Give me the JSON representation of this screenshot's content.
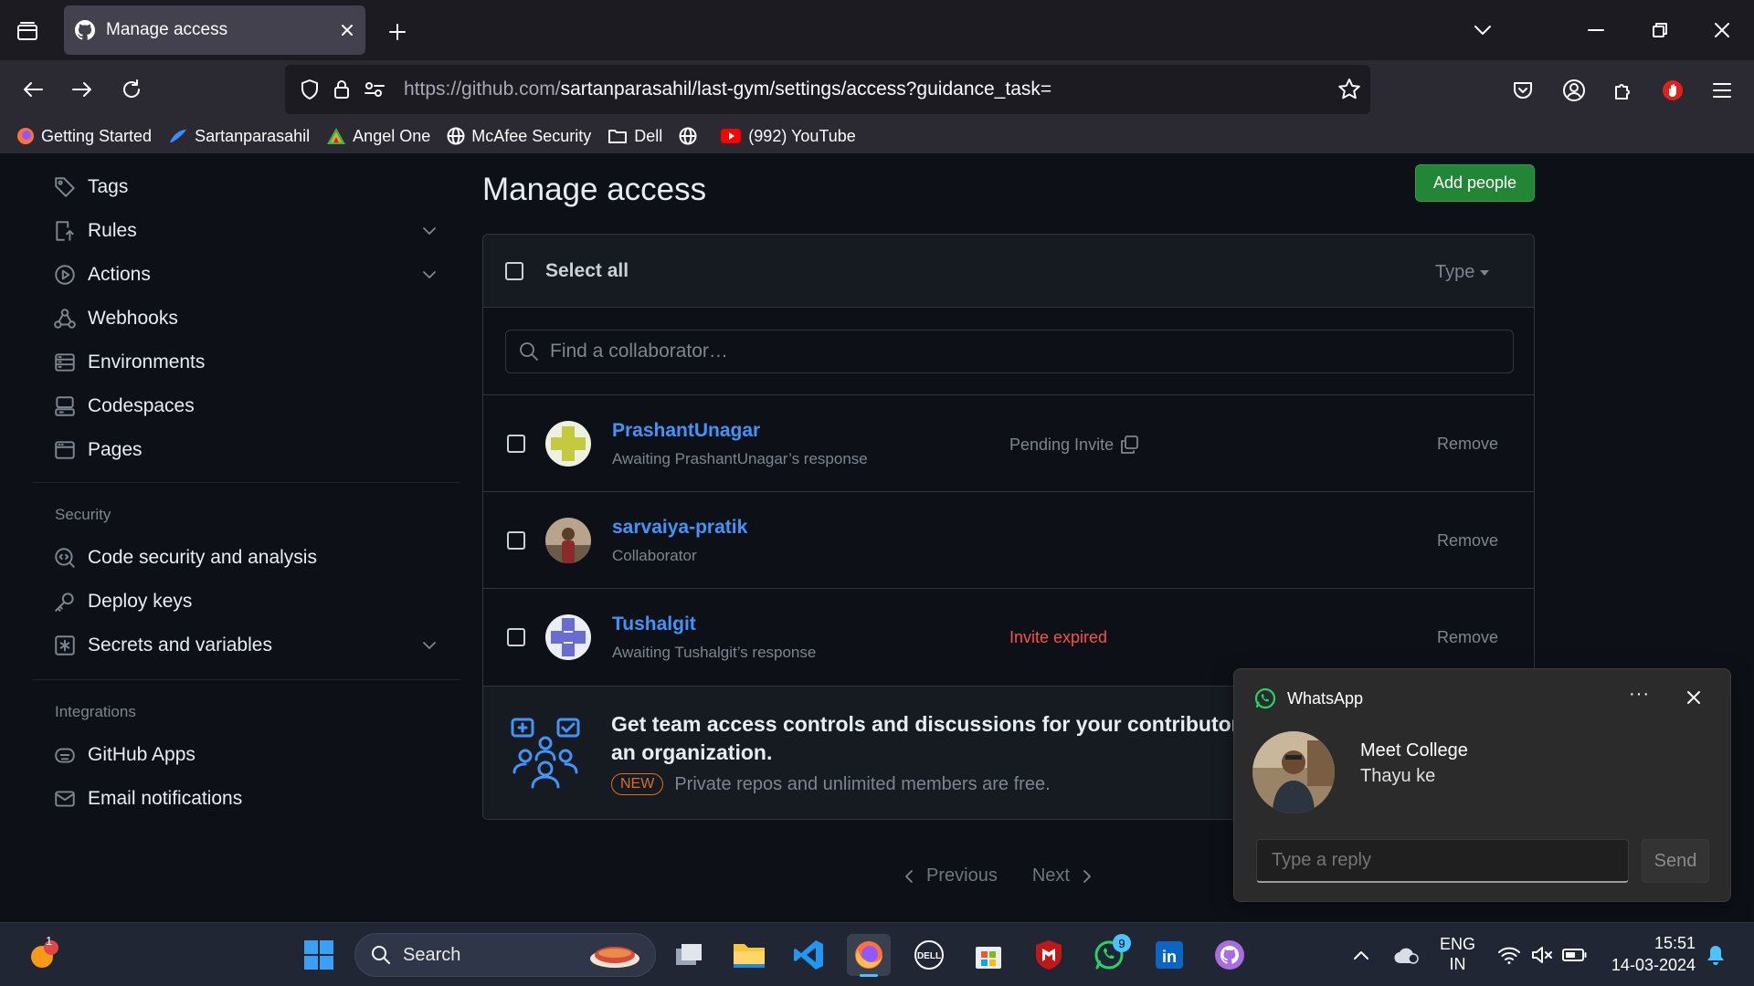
{
  "browser": {
    "tab_title": "Manage access",
    "url_host": "https://github.com/",
    "url_path": "sartanparasahil/last-gym/settings/access?guidance_task=",
    "bookmarks": [
      "Getting Started",
      "Sartanparasahil",
      "Angel One",
      "McAfee Security",
      "Dell",
      "(992) YouTube"
    ]
  },
  "sidebar": {
    "items_top": [
      {
        "label": "Tags",
        "icon": "tag-icon"
      },
      {
        "label": "Rules",
        "icon": "rules-icon",
        "expandable": true
      },
      {
        "label": "Actions",
        "icon": "play-icon",
        "expandable": true
      },
      {
        "label": "Webhooks",
        "icon": "webhook-icon"
      },
      {
        "label": "Environments",
        "icon": "server-icon"
      },
      {
        "label": "Codespaces",
        "icon": "codespaces-icon"
      },
      {
        "label": "Pages",
        "icon": "browser-icon"
      }
    ],
    "security_heading": "Security",
    "security_items": [
      {
        "label": "Code security and analysis",
        "icon": "codescan-icon"
      },
      {
        "label": "Deploy keys",
        "icon": "key-icon"
      },
      {
        "label": "Secrets and variables",
        "icon": "asterisk-icon",
        "expandable": true
      }
    ],
    "integrations_heading": "Integrations",
    "integrations_items": [
      {
        "label": "GitHub Apps",
        "icon": "hubot-icon"
      },
      {
        "label": "Email notifications",
        "icon": "mail-icon"
      }
    ]
  },
  "main": {
    "title": "Manage access",
    "add_people": "Add people",
    "select_all": "Select all",
    "type_filter": "Type",
    "search_placeholder": "Find a collaborator…",
    "collaborators": [
      {
        "name": "PrashantUnagar",
        "sub": "Awaiting PrashantUnagar’s response",
        "status": "Pending Invite",
        "status_color": "#7d8590",
        "remove": "Remove"
      },
      {
        "name": "sarvaiya-pratik",
        "sub": "Collaborator",
        "status": "",
        "status_color": "#7d8590",
        "remove": "Remove"
      },
      {
        "name": "Tushalgit",
        "sub": "Awaiting Tushalgit’s response",
        "status": "Invite expired",
        "status_color": "#f85149",
        "remove": "Remove"
      }
    ],
    "promo": {
      "title_line1": "Get team access controls and discussions for your contributors",
      "title_line2": "an organization.",
      "badge": "NEW",
      "text": "Private repos and unlimited members are free."
    },
    "pager": {
      "previous": "Previous",
      "next": "Next"
    }
  },
  "toast": {
    "app": "WhatsApp",
    "more": "···",
    "sender": "Meet College",
    "message": "Thayu ke",
    "reply_placeholder": "Type a reply",
    "send": "Send"
  },
  "taskbar": {
    "search_label": "Search",
    "lang_top": "ENG",
    "lang_bottom": "IN",
    "time": "15:51",
    "date": "14-03-2024",
    "notif_badge": "1",
    "whatsapp_badge": "9"
  }
}
